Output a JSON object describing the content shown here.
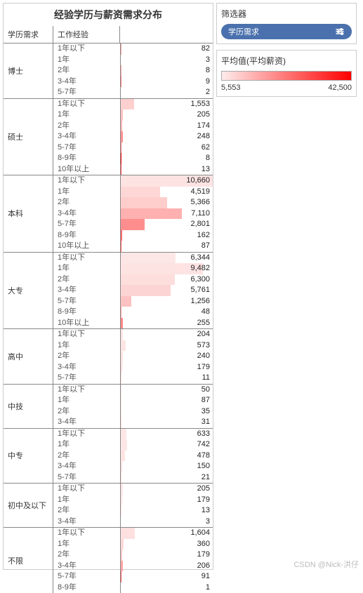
{
  "chart_data": {
    "type": "bar",
    "title": "经验学历与薪资需求分布",
    "col_headers": {
      "edu": "学历需求",
      "exp": "工作经验"
    },
    "x_max": 10660,
    "color_scale": {
      "min": 5553,
      "max": 42500,
      "min_color": "#fdeceb",
      "max_color": "#ff0000"
    },
    "groups": [
      {
        "edu": "博士",
        "rows": [
          {
            "exp": "1年以下",
            "val": 82,
            "c": 0.32
          },
          {
            "exp": "1年",
            "val": 3,
            "c": 0.55
          },
          {
            "exp": "2年",
            "val": 8,
            "c": 0.3
          },
          {
            "exp": "3-4年",
            "val": 9,
            "c": 0.5
          },
          {
            "exp": "5-7年",
            "val": 2,
            "c": 0.22
          }
        ]
      },
      {
        "edu": "硕士",
        "rows": [
          {
            "exp": "1年以下",
            "val": 1553,
            "c": 0.12
          },
          {
            "exp": "1年",
            "val": 205,
            "c": 0.18
          },
          {
            "exp": "2年",
            "val": 174,
            "c": 0.22
          },
          {
            "exp": "3-4年",
            "val": 248,
            "c": 0.38
          },
          {
            "exp": "5-7年",
            "val": 62,
            "c": 0.5
          },
          {
            "exp": "8-9年",
            "val": 8,
            "c": 0.98
          },
          {
            "exp": "10年以上",
            "val": 13,
            "c": 0.7
          }
        ]
      },
      {
        "edu": "本科",
        "rows": [
          {
            "exp": "1年以下",
            "val": 10660,
            "c": 0.04
          },
          {
            "exp": "1年",
            "val": 4519,
            "c": 0.09
          },
          {
            "exp": "2年",
            "val": 5366,
            "c": 0.13
          },
          {
            "exp": "3-4年",
            "val": 7110,
            "c": 0.25
          },
          {
            "exp": "5-7年",
            "val": 2801,
            "c": 0.4
          },
          {
            "exp": "8-9年",
            "val": 162,
            "c": 0.55
          },
          {
            "exp": "10年以上",
            "val": 87,
            "c": 0.6
          }
        ]
      },
      {
        "edu": "大专",
        "rows": [
          {
            "exp": "1年以下",
            "val": 6344,
            "c": 0.02
          },
          {
            "exp": "1年",
            "val": 9482,
            "c": 0.04
          },
          {
            "exp": "2年",
            "val": 6300,
            "c": 0.06
          },
          {
            "exp": "3-4年",
            "val": 5761,
            "c": 0.1
          },
          {
            "exp": "5-7年",
            "val": 1256,
            "c": 0.18
          },
          {
            "exp": "8-9年",
            "val": 48,
            "c": 0.32
          },
          {
            "exp": "10年以上",
            "val": 255,
            "c": 0.42
          }
        ]
      },
      {
        "edu": "高中",
        "rows": [
          {
            "exp": "1年以下",
            "val": 204,
            "c": 0.02
          },
          {
            "exp": "1年",
            "val": 573,
            "c": 0.03
          },
          {
            "exp": "2年",
            "val": 240,
            "c": 0.03
          },
          {
            "exp": "3-4年",
            "val": 179,
            "c": 0.06
          },
          {
            "exp": "5-7年",
            "val": 11,
            "c": 0.05
          }
        ]
      },
      {
        "edu": "中技",
        "rows": [
          {
            "exp": "1年以下",
            "val": 50,
            "c": 0.02
          },
          {
            "exp": "1年",
            "val": 87,
            "c": 0.02
          },
          {
            "exp": "2年",
            "val": 35,
            "c": 0.02
          },
          {
            "exp": "3-4年",
            "val": 31,
            "c": 0.04
          }
        ]
      },
      {
        "edu": "中专",
        "rows": [
          {
            "exp": "1年以下",
            "val": 633,
            "c": 0.02
          },
          {
            "exp": "1年",
            "val": 742,
            "c": 0.02
          },
          {
            "exp": "2年",
            "val": 478,
            "c": 0.03
          },
          {
            "exp": "3-4年",
            "val": 150,
            "c": 0.04
          },
          {
            "exp": "5-7年",
            "val": 21,
            "c": 0.06
          }
        ]
      },
      {
        "edu": "初中及以下",
        "rows": [
          {
            "exp": "1年以下",
            "val": 205,
            "c": 0.02
          },
          {
            "exp": "1年",
            "val": 179,
            "c": 0.02
          },
          {
            "exp": "2年",
            "val": 13,
            "c": 0.03
          },
          {
            "exp": "3-4年",
            "val": 3,
            "c": 0.05
          }
        ]
      },
      {
        "edu": "不限",
        "rows": [
          {
            "exp": "1年以下",
            "val": 1604,
            "c": 0.05
          },
          {
            "exp": "1年",
            "val": 360,
            "c": 0.08
          },
          {
            "exp": "2年",
            "val": 179,
            "c": 0.14
          },
          {
            "exp": "3-4年",
            "val": 206,
            "c": 0.3
          },
          {
            "exp": "5-7年",
            "val": 91,
            "c": 0.65
          },
          {
            "exp": "8-9年",
            "val": 1,
            "c": 0.95
          }
        ]
      }
    ]
  },
  "filter": {
    "title": "筛选器",
    "pill": "学历需求"
  },
  "legend": {
    "title": "平均值(平均薪资)",
    "min": "5,553",
    "max": "42,500"
  },
  "watermark": "CSDN @Nick-洪仔"
}
